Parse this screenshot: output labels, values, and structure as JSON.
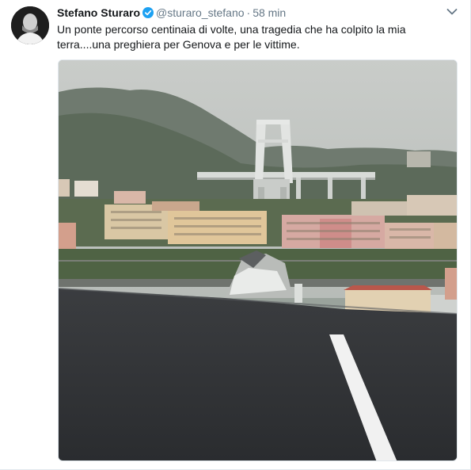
{
  "tweet": {
    "author_name": "Stefano Sturaro",
    "handle": "@sturaro_stefano",
    "separator": "·",
    "time": "58 min",
    "verified_icon": "verified-badge-icon",
    "menu_icon": "chevron-down-icon",
    "text": "Un ponte percorso centinaia di volte, una tragedia che ha colpito la mia terra....una preghiera per Genova e per le vittime.",
    "accent_color": "#1da1f2"
  }
}
